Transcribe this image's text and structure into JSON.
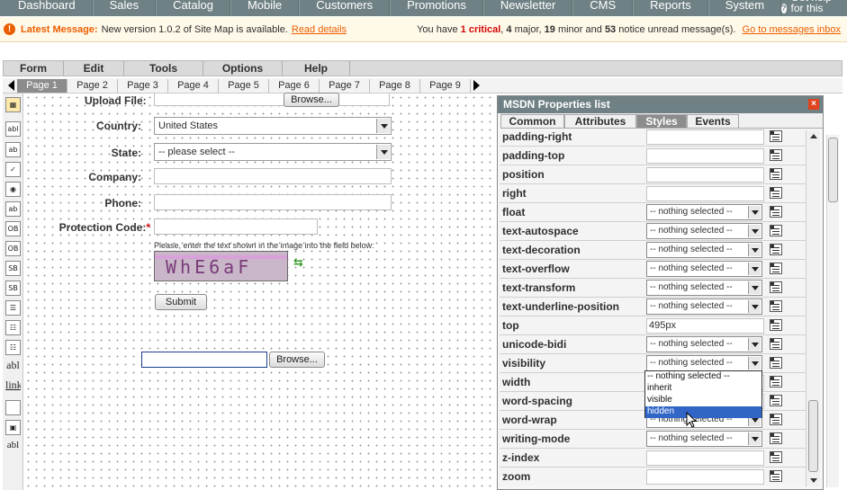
{
  "topnav": {
    "items": [
      "Dashboard",
      "Sales",
      "Catalog",
      "Mobile",
      "Customers",
      "Promotions",
      "Newsletter",
      "CMS",
      "Reports",
      "System"
    ],
    "help": "Get help for this page"
  },
  "message": {
    "latest_label": "Latest Message:",
    "text": "New version 1.0.2 of Site Map is available.",
    "link": "Read details",
    "summary_prefix": "You have",
    "critical": "1 critical",
    "major": "4",
    "major_label": "major,",
    "minor": "19",
    "minor_label": "minor and",
    "notice": "53",
    "notice_label": "notice unread message(s).",
    "inbox_link": "Go to messages inbox"
  },
  "menubar": [
    "Form",
    "Edit",
    "Tools",
    "Options",
    "Help"
  ],
  "page_tabs": [
    "Page 1",
    "Page 2",
    "Page 3",
    "Page 4",
    "Page 5",
    "Page 6",
    "Page 7",
    "Page 8",
    "Page 9"
  ],
  "toolbox": {
    "t_abl": "abl",
    "t_abl2": "abl",
    "t_link": "link"
  },
  "form": {
    "upload_label": "Upload File:",
    "browse_label": "Browse...",
    "country_label": "Country:",
    "country_value": "United States",
    "state_label": "State:",
    "state_value": "-- please select --",
    "company_label": "Company:",
    "phone_label": "Phone:",
    "protection_label": "Protection Code:",
    "required_mark": "*",
    "captcha_hint": "Please, enter the text shown in the image into the field below:",
    "captcha_text": "WhE6aF",
    "submit_label": "Submit",
    "browse2_label": "Browse..."
  },
  "props": {
    "title": "MSDN Properties list",
    "tabs": [
      "Common",
      "Attributes",
      "Styles",
      "Events"
    ],
    "rows": [
      {
        "name": "padding-right",
        "kind": "input",
        "value": ""
      },
      {
        "name": "padding-top",
        "kind": "input",
        "value": ""
      },
      {
        "name": "position",
        "kind": "input",
        "value": ""
      },
      {
        "name": "right",
        "kind": "input",
        "value": ""
      },
      {
        "name": "float",
        "kind": "select",
        "value": "-- nothing selected --"
      },
      {
        "name": "text-autospace",
        "kind": "select",
        "value": "-- nothing selected --"
      },
      {
        "name": "text-decoration",
        "kind": "select",
        "value": "-- nothing selected --"
      },
      {
        "name": "text-overflow",
        "kind": "select",
        "value": "-- nothing selected --"
      },
      {
        "name": "text-transform",
        "kind": "select",
        "value": "-- nothing selected --"
      },
      {
        "name": "text-underline-position",
        "kind": "select",
        "value": "-- nothing selected --"
      },
      {
        "name": "top",
        "kind": "input",
        "value": "495px"
      },
      {
        "name": "unicode-bidi",
        "kind": "select",
        "value": "-- nothing selected --"
      },
      {
        "name": "visibility",
        "kind": "select",
        "value": "-- nothing selected --"
      },
      {
        "name": "width",
        "kind": "input",
        "value": ""
      },
      {
        "name": "word-spacing",
        "kind": "input",
        "value": ""
      },
      {
        "name": "word-wrap",
        "kind": "select",
        "value": "-- nothing selected --"
      },
      {
        "name": "writing-mode",
        "kind": "select",
        "value": "-- nothing selected --"
      },
      {
        "name": "z-index",
        "kind": "input",
        "value": ""
      },
      {
        "name": "zoom",
        "kind": "input",
        "value": ""
      }
    ],
    "dropdown_options": [
      "-- nothing selected --",
      "inherit",
      "visible",
      "hidden"
    ],
    "dropdown_selected": "hidden"
  }
}
